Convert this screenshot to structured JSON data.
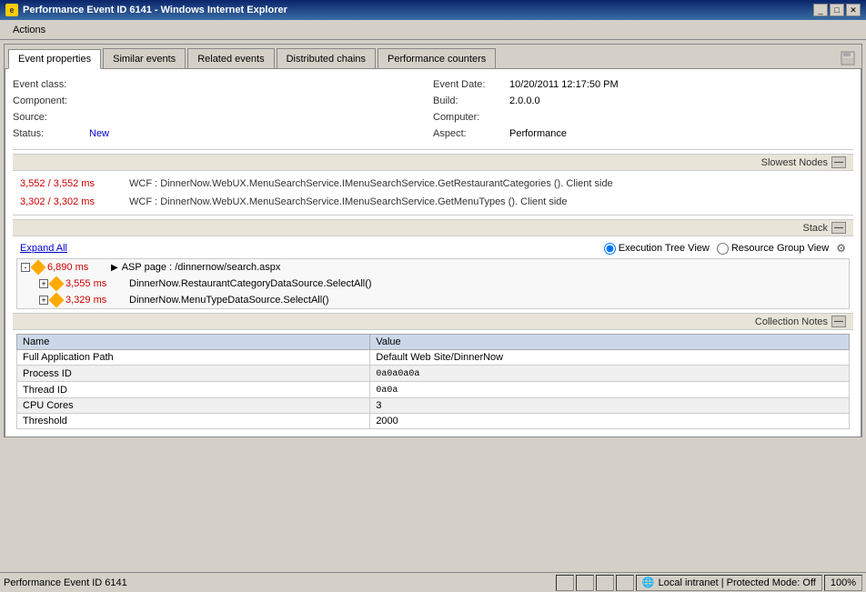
{
  "titleBar": {
    "title": "Performance Event ID 6141 - Windows Internet Explorer",
    "buttons": [
      "_",
      "□",
      "✕"
    ]
  },
  "menuBar": {
    "items": [
      "Actions"
    ]
  },
  "tabs": [
    {
      "label": "Event properties",
      "active": true
    },
    {
      "label": "Similar events",
      "active": false
    },
    {
      "label": "Related events",
      "active": false
    },
    {
      "label": "Distributed chains",
      "active": false
    },
    {
      "label": "Performance counters",
      "active": false
    }
  ],
  "eventProperties": {
    "eventClass": {
      "label": "Event class:",
      "value": ""
    },
    "component": {
      "label": "Component:",
      "value": ""
    },
    "source": {
      "label": "Source:",
      "value": ""
    },
    "status": {
      "label": "Status:",
      "value": "New"
    },
    "eventDate": {
      "label": "Event Date:",
      "value": "10/20/2011 12:17:50 PM"
    },
    "build": {
      "label": "Build:",
      "value": "2.0.0.0"
    },
    "computer": {
      "label": "Computer:",
      "value": ""
    },
    "aspect": {
      "label": "Aspect:",
      "value": "Performance"
    }
  },
  "slowestNodes": {
    "title": "Slowest Nodes",
    "items": [
      {
        "time": "3,552 / 3,552 ms",
        "description": "WCF : DinnerNow.WebUX.MenuSearchService.IMenuSearchService.GetRestaurantCategories (). Client side"
      },
      {
        "time": "3,302 / 3,302 ms",
        "description": "WCF : DinnerNow.WebUX.MenuSearchService.IMenuSearchService.GetMenuTypes (). Client side"
      }
    ]
  },
  "stack": {
    "title": "Stack",
    "expandAll": "Expand All",
    "radioOptions": [
      "Execution Tree View",
      "Resource Group View"
    ],
    "selectedRadio": 0,
    "treeItems": [
      {
        "level": 1,
        "expanded": true,
        "time": "6,890 ms",
        "hasIcon": true,
        "hasDiamond": false,
        "label": "ASP page : /dinnernow/search.aspx",
        "collapse": true
      },
      {
        "level": 2,
        "expanded": true,
        "time": "3,555 ms",
        "hasIcon": true,
        "hasDiamond": true,
        "label": "DinnerNow.RestaurantCategoryDataSource.SelectAll()"
      },
      {
        "level": 2,
        "expanded": false,
        "time": "3,329 ms",
        "hasIcon": true,
        "hasDiamond": true,
        "label": "DinnerNow.MenuTypeDataSource.SelectAll()"
      }
    ]
  },
  "collectionNotes": {
    "title": "Collection Notes",
    "columns": [
      "Name",
      "Value"
    ],
    "rows": [
      {
        "name": "Full Application Path",
        "value": "Default Web Site/DinnerNow",
        "monospace": false
      },
      {
        "name": "Process ID",
        "value": "0a0a0a0a",
        "monospace": true
      },
      {
        "name": "Thread ID",
        "value": "0a0a",
        "monospace": true
      },
      {
        "name": "CPU Cores",
        "value": "3",
        "monospace": false
      },
      {
        "name": "Threshold",
        "value": "2000",
        "monospace": false
      }
    ]
  },
  "statusBar": {
    "text": "Performance Event ID 6141",
    "zone": "Local intranet | Protected Mode: Off",
    "zoom": "100%"
  }
}
